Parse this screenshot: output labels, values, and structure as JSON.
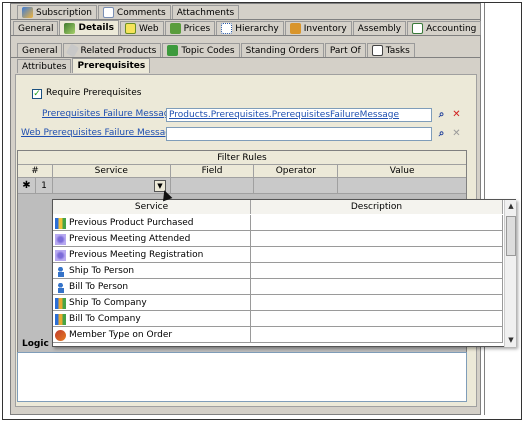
{
  "tabs_row1": [
    {
      "label": "Subscription",
      "icon": "subscription-icon"
    },
    {
      "label": "Comments",
      "icon": "comments-icon"
    },
    {
      "label": "Attachments",
      "icon": ""
    }
  ],
  "tabs_row2": [
    {
      "label": "General",
      "icon": ""
    },
    {
      "label": "Details",
      "icon": "details-icon"
    },
    {
      "label": "Web",
      "icon": "web-icon"
    },
    {
      "label": "Prices",
      "icon": "prices-icon"
    },
    {
      "label": "Hierarchy",
      "icon": "hierarchy-icon"
    },
    {
      "label": "Inventory",
      "icon": "inventory-icon"
    },
    {
      "label": "Assembly",
      "icon": ""
    },
    {
      "label": "Accounting",
      "icon": "accounting-icon"
    }
  ],
  "tabs_row3": [
    {
      "label": "General",
      "icon": ""
    },
    {
      "label": "Related Products",
      "icon": "related-products-icon"
    },
    {
      "label": "Topic Codes",
      "icon": "topic-codes-icon"
    },
    {
      "label": "Standing Orders",
      "icon": ""
    },
    {
      "label": "Part Of",
      "icon": ""
    },
    {
      "label": "Tasks",
      "icon": "tasks-icon"
    }
  ],
  "tabs_row4": [
    {
      "label": "Attributes"
    },
    {
      "label": "Prerequisites"
    }
  ],
  "require_prereq": {
    "label": "Require Prerequisites",
    "checked": true
  },
  "failure_msg": {
    "label": "Prerequisites Failure Message",
    "value": "Products.Prerequisites.PrerequisitesFailureMessage"
  },
  "web_failure_msg": {
    "label": "Web Prerequisites Failure Message",
    "value": ""
  },
  "filter_rules": {
    "caption": "Filter Rules",
    "columns": [
      "#",
      "Service",
      "Field",
      "Operator",
      "Value"
    ],
    "row": {
      "marker": "✱",
      "number": "1"
    }
  },
  "dropdown": {
    "columns": [
      "Service",
      "Description"
    ],
    "items": [
      {
        "label": "Previous Product Purchased",
        "icon": "chart-icon"
      },
      {
        "label": "Previous Meeting Attended",
        "icon": "meeting-icon"
      },
      {
        "label": "Previous Meeting Registration",
        "icon": "meeting-icon"
      },
      {
        "label": "Ship To Person",
        "icon": "person-icon"
      },
      {
        "label": "Bill To Person",
        "icon": "person-icon"
      },
      {
        "label": "Ship To Company",
        "icon": "company-icon"
      },
      {
        "label": "Bill To Company",
        "icon": "company-icon"
      },
      {
        "label": "Member Type on Order",
        "icon": "member-icon"
      }
    ]
  },
  "logic_label": "Logic S",
  "colors": {
    "panel": "#d4d0c8",
    "content": "#ece9d8",
    "link": "#1f4fb0"
  }
}
